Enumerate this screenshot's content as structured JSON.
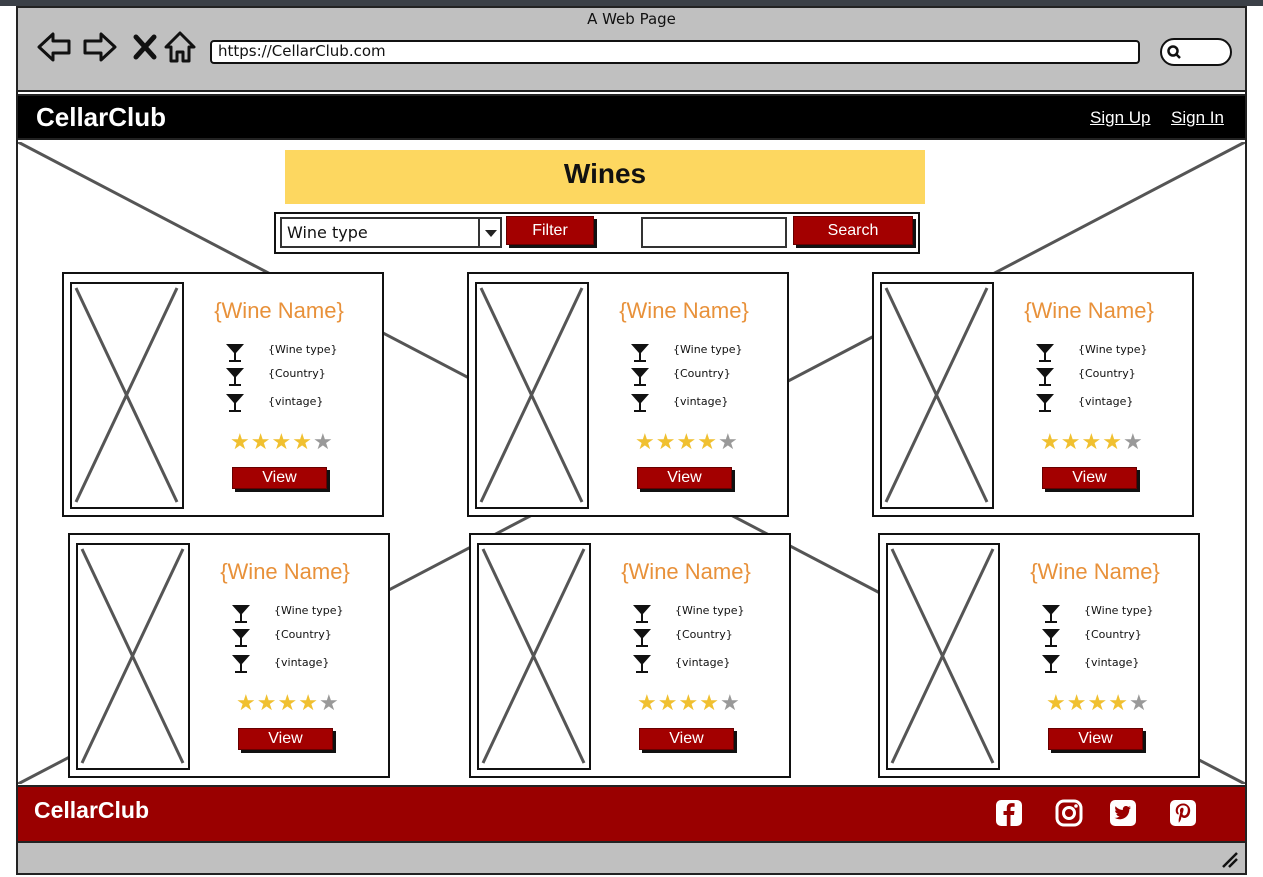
{
  "window": {
    "title": "A Web Page"
  },
  "browser": {
    "url": "https://CellarClub.com"
  },
  "header": {
    "brand": "CellarClub",
    "sign_up": "Sign Up",
    "sign_in": "Sign In"
  },
  "page": {
    "title": "Wines"
  },
  "filter": {
    "select_value": "Wine type",
    "filter_label": "Filter",
    "search_label": "Search",
    "search_value": ""
  },
  "cards": [
    {
      "name": "{Wine Name}",
      "type": "{Wine type}",
      "country": "{Country}",
      "vintage": "{vintage}",
      "rating": 4,
      "rating_max": 5,
      "view_label": "View"
    },
    {
      "name": "{Wine Name}",
      "type": "{Wine type}",
      "country": "{Country}",
      "vintage": "{vintage}",
      "rating": 4,
      "rating_max": 5,
      "view_label": "View"
    },
    {
      "name": "{Wine Name}",
      "type": "{Wine type}",
      "country": "{Country}",
      "vintage": "{vintage}",
      "rating": 4,
      "rating_max": 5,
      "view_label": "View"
    },
    {
      "name": "{Wine Name}",
      "type": "{Wine type}",
      "country": "{Country}",
      "vintage": "{vintage}",
      "rating": 4,
      "rating_max": 5,
      "view_label": "View"
    },
    {
      "name": "{Wine Name}",
      "type": "{Wine type}",
      "country": "{Country}",
      "vintage": "{vintage}",
      "rating": 4,
      "rating_max": 5,
      "view_label": "View"
    },
    {
      "name": "{Wine Name}",
      "type": "{Wine type}",
      "country": "{Country}",
      "vintage": "{vintage}",
      "rating": 4,
      "rating_max": 5,
      "view_label": "View"
    }
  ],
  "footer": {
    "brand": "CellarClub",
    "social_icons": [
      "facebook-icon",
      "instagram-icon",
      "twitter-icon",
      "pinterest-icon"
    ]
  },
  "colors": {
    "header_bg": "#000000",
    "footer_bg": "#9a0000",
    "button_bg": "#a30000",
    "banner_bg": "#fdd760",
    "wine_name": "#e8913a",
    "star_on": "#f0c030",
    "star_off": "#999999"
  }
}
